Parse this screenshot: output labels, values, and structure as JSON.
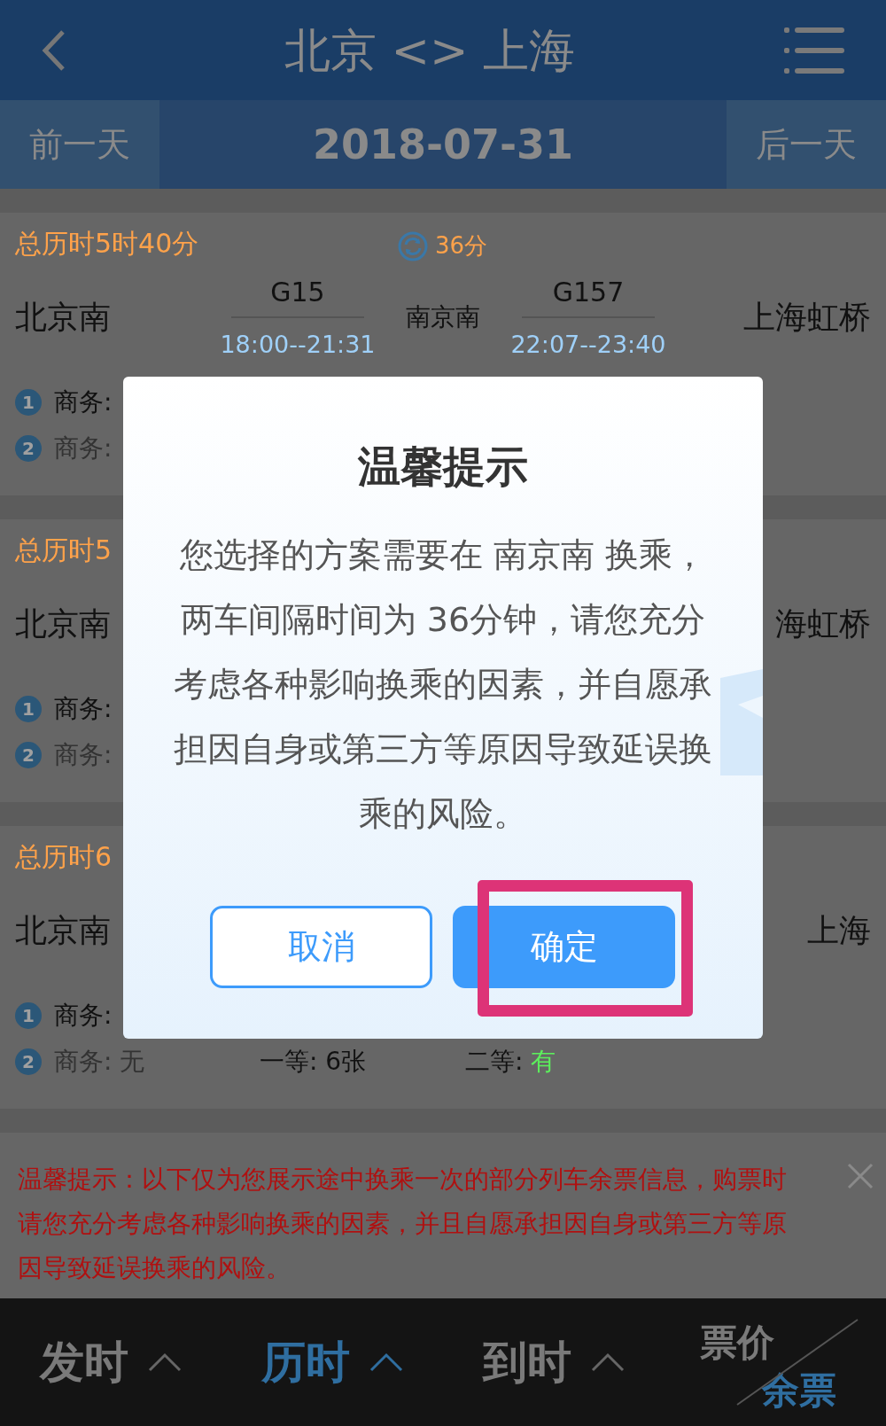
{
  "header": {
    "title": "北京 <> 上海"
  },
  "date_bar": {
    "prev": "前一天",
    "date": "2018-07-31",
    "next": "后一天"
  },
  "itineraries": [
    {
      "duration": "总历时5时40分",
      "transfer_time": "36分",
      "from": "北京南",
      "via": "南京南",
      "to": "上海虹桥",
      "legs": [
        {
          "train": "G15",
          "time": "18:00--21:31"
        },
        {
          "train": "G157",
          "time": "22:07--23:40"
        }
      ],
      "seats": [
        {
          "index": "1",
          "items": [
            {
              "label": "商务:",
              "available": true
            }
          ]
        },
        {
          "index": "2",
          "items": [
            {
              "label": "商务:",
              "available": false
            }
          ]
        }
      ]
    },
    {
      "duration": "总历时5",
      "from": "北京南",
      "to": "海虹桥",
      "seats": [
        {
          "index": "1",
          "items": [
            {
              "label": "商务:",
              "available": true
            }
          ]
        },
        {
          "index": "2",
          "items": [
            {
              "label": "商务:",
              "available": false
            }
          ]
        }
      ]
    },
    {
      "duration": "总历时6",
      "from": "北京南",
      "to": "上海",
      "seats": [
        {
          "index": "1",
          "items": [
            {
              "label": "商务:",
              "available": true
            }
          ]
        },
        {
          "index": "2",
          "items": [
            {
              "label": "商务: 无",
              "available": false
            },
            {
              "label": "一等: 6张",
              "available": true
            },
            {
              "label": "二等:",
              "value": "有",
              "plenty": true,
              "available": true
            }
          ]
        }
      ]
    }
  ],
  "notice": {
    "text": "温馨提示：以下仅为您展示途中换乘一次的部分列车余票信息，购票时请您充分考虑各种影响换乘的因素，并且自愿承担因自身或第三方等原因导致延误换乘的风险。"
  },
  "sort_bar": [
    {
      "label": "发时",
      "selected": false
    },
    {
      "label": "历时",
      "selected": true
    },
    {
      "label": "到时",
      "selected": false
    }
  ],
  "price_toggle": {
    "top": "票价",
    "bottom": "余票"
  },
  "dialog": {
    "title": "温馨提示",
    "message": "您选择的方案需要在 南京南 换乘，两车间隔时间为 36分钟，请您充分考虑各种影响换乘的因素，并自愿承担因自身或第三方等原因导致延误换乘的风险。",
    "buttons": [
      {
        "label": "取消",
        "kind": "secondary"
      },
      {
        "label": "确定",
        "kind": "primary",
        "highlighted": true
      }
    ]
  }
}
